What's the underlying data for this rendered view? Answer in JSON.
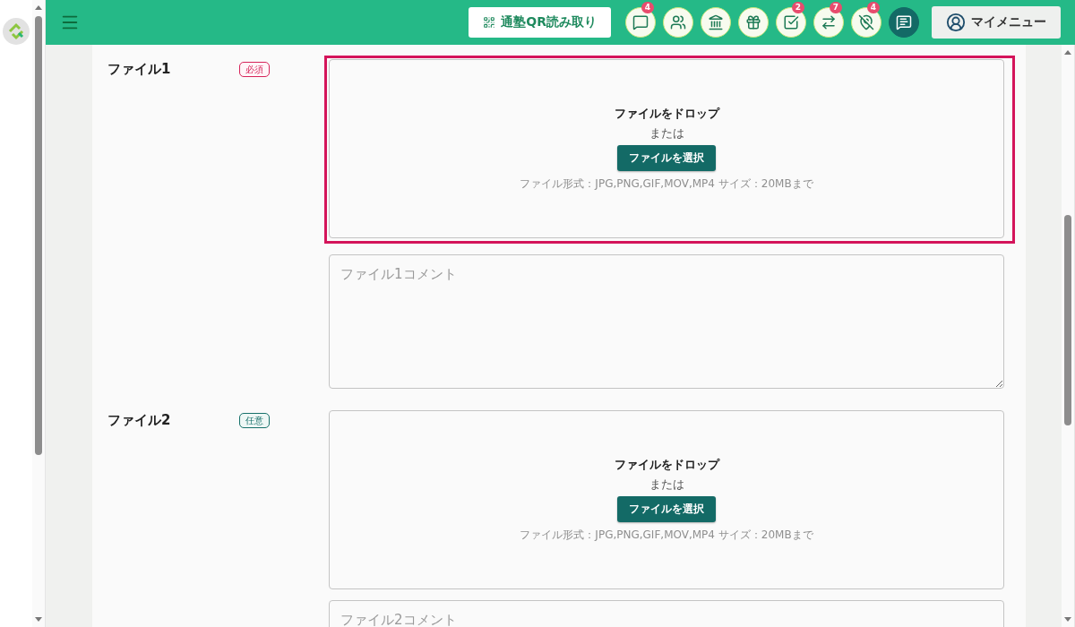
{
  "header": {
    "qr_button": "通塾QR読み取り",
    "icon_buttons": [
      {
        "badge": "4",
        "selected": false
      },
      {
        "selected": false
      },
      {
        "selected": false
      },
      {
        "selected": false
      },
      {
        "badge": "2",
        "selected": false
      },
      {
        "badge": "7",
        "selected": false
      },
      {
        "badge": "4",
        "selected": false
      },
      {
        "selected": true
      }
    ],
    "my_menu": "マイメニュー"
  },
  "fields": [
    {
      "label": "ファイル1",
      "tag": "必須",
      "kind": "required",
      "highlighted": true,
      "drop_title": "ファイルをドロップ",
      "or": "または",
      "select_button": "ファイルを選択",
      "note": "ファイル形式：JPG,PNG,GIF,MOV,MP4 サイズ：20MBまで",
      "comment_placeholder": "ファイル1コメント"
    },
    {
      "label": "ファイル2",
      "tag": "任意",
      "kind": "optional",
      "highlighted": false,
      "drop_title": "ファイルをドロップ",
      "or": "または",
      "select_button": "ファイルを選択",
      "note": "ファイル形式：JPG,PNG,GIF,MOV,MP4 サイズ：20MBまで",
      "comment_placeholder": "ファイル2コメント"
    }
  ]
}
